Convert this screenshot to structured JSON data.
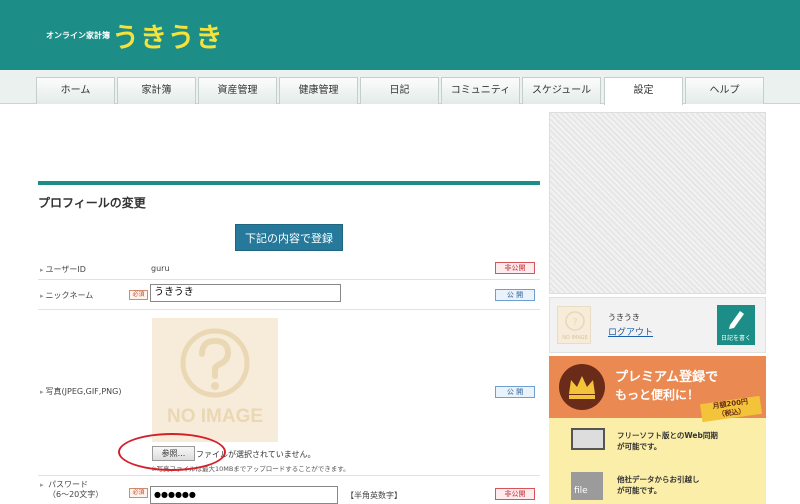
{
  "header": {
    "subtitle": "オンライン家計簿",
    "logo": "うきうき"
  },
  "tabs": [
    "ホーム",
    "家計簿",
    "資産管理",
    "健康管理",
    "日記",
    "コミュニティ",
    "スケジュール",
    "設定",
    "ヘルプ"
  ],
  "active_tab": "設定",
  "page": {
    "title": "プロフィールの変更",
    "submit_label": "下記の内容で登録"
  },
  "required_label": "必須",
  "fields": {
    "userid": {
      "label": "ユーザーID",
      "value": "guru",
      "visibility": "非公開"
    },
    "nickname": {
      "label": "ニックネーム",
      "value": "うきうき",
      "visibility": "公 開"
    },
    "photo": {
      "label": "写真(JPEG,GIF,PNG)",
      "placeholder_text": "NO IMAGE",
      "browse_label": "参照...",
      "no_file_text": "ファイルが選択されていません。",
      "note": "※写真ファイルは最大10MBまでアップロードすることができます。",
      "visibility": "公 開"
    },
    "password": {
      "label": "パスワード",
      "sublabel": "（6～20文字）",
      "value": "●●●●●●",
      "hint": "【半角英数字】",
      "visibility": "非公開"
    }
  },
  "sidebar": {
    "user_name": "うきうき",
    "logout_label": "ログアウト",
    "avatar_text": "NO IMAGE",
    "diary_button": "日記を書く",
    "premium": {
      "title": "プレミアム登録で",
      "title2": "もっと便利に！",
      "price": "月額200円",
      "price_note": "（税込）",
      "feature1_line1": "フリーソフト版とのWeb同期",
      "feature1_line2": "が可能です。",
      "feature2_line1": "他社データからお引越し",
      "feature2_line2": "が可能です。",
      "file_icon_text": "file"
    }
  },
  "colors": {
    "brand": "#1c8e87",
    "logo": "#f5e23b",
    "button": "#26799a",
    "premium": "#ea8a52",
    "annotation": "#d4202a"
  }
}
